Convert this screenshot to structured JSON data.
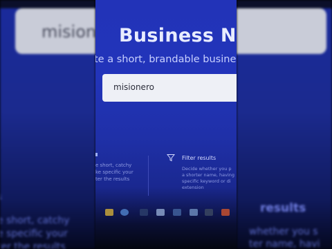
{
  "background": {
    "search_value": "misionero",
    "left_text": [
      "e short, catchy",
      "e specific your",
      "ter the results"
    ],
    "right_heading": "results",
    "right_text": [
      "whether you s",
      "ter name, havi"
    ]
  },
  "page": {
    "title": "Business Nam",
    "subtitle": "te a short, brandable business",
    "search": {
      "value": "misionero"
    },
    "features": {
      "left_lines": [
        "e short, catchy",
        "ke specific your",
        "ter the results"
      ],
      "filter": {
        "icon": "filter-icon",
        "title": "Filter results",
        "description": [
          "Decide whether you p",
          "a shorter name, having",
          "specific keyword or di",
          "extension"
        ]
      }
    }
  },
  "taskbar": {
    "icons": [
      "folder-icon",
      "browser-icon",
      "app-icon",
      "image-icon",
      "window-icon",
      "photo-icon",
      "terminal-icon",
      "app-icon-red"
    ]
  },
  "colors": {
    "brand_blue": "#2233b8",
    "search_bg": "#eef0f6",
    "text_light": "#e8ecff"
  }
}
